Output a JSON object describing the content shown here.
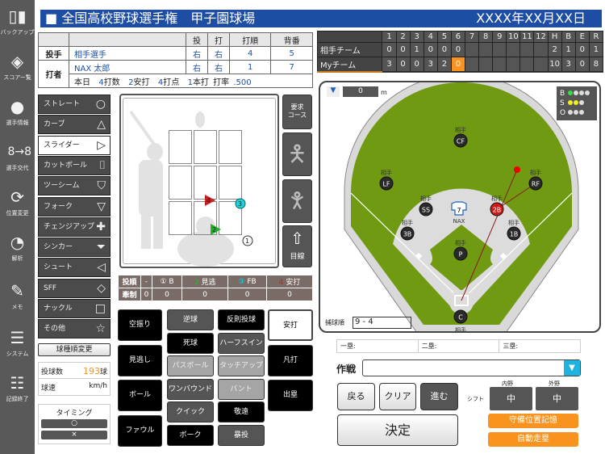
{
  "sidebar": [
    {
      "label": "バックアップ",
      "icon": "door-icon"
    },
    {
      "label": "スコアー覧",
      "icon": "scorebook-icon"
    },
    {
      "label": "選手情報",
      "icon": "player-icon"
    },
    {
      "label": "選手交代",
      "icon": "substitution-icon"
    },
    {
      "label": "位置変更",
      "icon": "position-change-icon"
    },
    {
      "label": "解析",
      "icon": "pie-chart-icon"
    },
    {
      "label": "メモ",
      "icon": "pencil-icon"
    },
    {
      "label": "システム",
      "icon": "menu-icon"
    },
    {
      "label": "記録終了",
      "icon": "list-icon"
    }
  ],
  "header": {
    "title": "■ 全国高校野球選手権　甲子園球場",
    "date": "XXXX年XX月XX日"
  },
  "players": {
    "headers": [
      "投",
      "打",
      "打順",
      "背番"
    ],
    "pitcher": {
      "role": "投手",
      "name": "相手選手",
      "throw": "右",
      "bat": "右",
      "order": "4",
      "number": "5"
    },
    "batter": {
      "role": "打者",
      "name": "NAX 太郎",
      "throw": "右",
      "bat": "右",
      "order": "1",
      "number": "7"
    },
    "today": {
      "label": "本日",
      "ab": "4",
      "ab_l": "打数",
      "h": "2",
      "h_l": "安打",
      "rbi": "4",
      "rbi_l": "打点",
      "hr": "1",
      "hr_l": "本打",
      "avg_l": "打率",
      "avg": ".500"
    }
  },
  "scoreboard": {
    "innings": [
      "1",
      "2",
      "3",
      "4",
      "5",
      "6",
      "7",
      "8",
      "9",
      "10",
      "11",
      "12",
      "H",
      "B",
      "E",
      "R"
    ],
    "teams": [
      {
        "name": "相手チーム",
        "cells": [
          "0",
          "0",
          "1",
          "0",
          "0",
          "0",
          "",
          "",
          "",
          "",
          "",
          "",
          "2",
          "1",
          "0",
          "1"
        ]
      },
      {
        "name": "Myチーム",
        "cells": [
          "3",
          "0",
          "0",
          "3",
          "2",
          "0",
          "",
          "",
          "",
          "",
          "",
          "",
          "10",
          "3",
          "0",
          "8"
        ]
      }
    ],
    "current_color": "#f7931e"
  },
  "pitches": [
    {
      "label": "ストレート",
      "sym": "○"
    },
    {
      "label": "カーブ",
      "sym": "△"
    },
    {
      "label": "スライダー",
      "sym": "▷",
      "selected": true
    },
    {
      "label": "カットボール",
      "sym": "⌷"
    },
    {
      "label": "ツーシーム",
      "sym": "⛉"
    },
    {
      "label": "フォーク",
      "sym": "▽"
    },
    {
      "label": "チェンジアップ",
      "sym": "✚"
    },
    {
      "label": "シンカー",
      "sym": "⏷"
    },
    {
      "label": "シュート",
      "sym": "◁"
    },
    {
      "label": "SFF",
      "sym": "◇"
    },
    {
      "label": "ナックル",
      "sym": "□"
    },
    {
      "label": "その他",
      "sym": "☆"
    }
  ],
  "reorder_label": "球種順変更",
  "count": {
    "label": "投球数",
    "value": "193",
    "unit": "球"
  },
  "speed": {
    "label": "球速",
    "unit": "km/h"
  },
  "timing": {
    "label": "タイミング",
    "ok": "○",
    "ng": "×"
  },
  "zone_buttons": {
    "request": "要求\nコース",
    "eye": "目線"
  },
  "markers": [
    {
      "n": "1"
    },
    {
      "n": "2"
    },
    {
      "n": "3"
    },
    {
      "n": "4"
    }
  ],
  "stats": {
    "row1": [
      "投順",
      "-",
      "①",
      "B",
      "2",
      "見逃",
      "③",
      "FB",
      "4",
      "安打"
    ],
    "row2": [
      "牽制",
      "0",
      "0",
      "0",
      "0",
      "0"
    ]
  },
  "actions": {
    "col1": [
      "空振り",
      "見逃し",
      "ボール",
      "ファウル"
    ],
    "col2": [
      "逆球",
      "死球",
      "パスボール",
      "ワンバウンド",
      "クイック",
      "ボーク"
    ],
    "col3": [
      "反則投球",
      "ハーフスイング",
      "タッチアップ",
      "バント",
      "敬遠",
      "暴投"
    ],
    "col4": [
      "安打",
      "凡打",
      "出塁"
    ]
  },
  "field": {
    "distance": "0",
    "distance_unit": "m",
    "bso": {
      "b": "B",
      "s": "S",
      "o": "O",
      "balls": 1,
      "strikes": 2,
      "outs": 0
    },
    "opp": "相手",
    "positions": [
      "CF",
      "LF",
      "SS",
      "2B",
      "RF",
      "3B",
      "1B",
      "P",
      "C"
    ],
    "runner": {
      "number": "7",
      "team": "NAX"
    },
    "catch_order_label": "捕球順",
    "catch_order": "9 - 4"
  },
  "bases": [
    "一塁:",
    "二塁:",
    "三塁:"
  ],
  "strategy": {
    "label": "作戦",
    "value": ""
  },
  "nav": {
    "back": "戻る",
    "clear": "クリア",
    "next": "進む",
    "decide": "決定"
  },
  "shift": {
    "label": "シフト",
    "infield_label": "内野",
    "outfield_label": "外野",
    "infield": "中",
    "outfield": "中"
  },
  "memory": "守備位置記憶",
  "auto_run": "自動走塁"
}
